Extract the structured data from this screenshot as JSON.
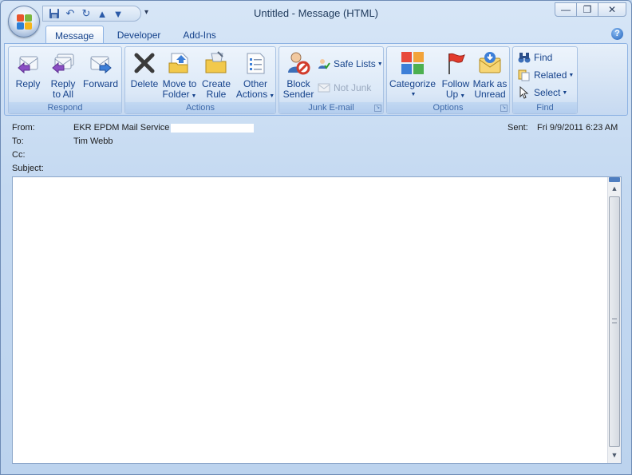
{
  "window": {
    "title": "Untitled - Message (HTML)",
    "controls": {
      "minimize": "—",
      "restore": "❐",
      "close": "✕"
    }
  },
  "qat": {
    "customize": "▾"
  },
  "tabs": [
    {
      "label": "Message",
      "active": true
    },
    {
      "label": "Developer",
      "active": false
    },
    {
      "label": "Add-Ins",
      "active": false
    }
  ],
  "help": "?",
  "ribbon": {
    "respond": {
      "label": "Respond",
      "reply": [
        "Reply",
        ""
      ],
      "reply_all": [
        "Reply",
        "to All"
      ],
      "forward": [
        "Forward",
        ""
      ]
    },
    "actions": {
      "label": "Actions",
      "delete": [
        "Delete",
        ""
      ],
      "move": [
        "Move to",
        "Folder"
      ],
      "create_rule": [
        "Create",
        "Rule"
      ],
      "other": [
        "Other",
        "Actions"
      ]
    },
    "junk": {
      "label": "Junk E-mail",
      "block": [
        "Block",
        "Sender"
      ],
      "safe_lists": "Safe Lists",
      "not_junk": "Not Junk"
    },
    "options": {
      "label": "Options",
      "categorize": [
        "Categorize",
        ""
      ],
      "follow_up": [
        "Follow",
        "Up"
      ],
      "mark_unread": [
        "Mark as",
        "Unread"
      ]
    },
    "find": {
      "label": "Find",
      "find": "Find",
      "related": "Related",
      "select": "Select"
    }
  },
  "header": {
    "from_label": "From:",
    "from_value": "EKR EPDM Mail Service",
    "to_label": "To:",
    "to_value": "Tim Webb",
    "cc_label": "Cc:",
    "subject_label": "Subject:",
    "sent_label": "Sent:",
    "sent_value": "Fri 9/9/2011 6:23 AM"
  },
  "colors": {
    "accent": "#15428b",
    "ribbon_bg": "#d3e2f4",
    "frame": "#bfd5ee"
  }
}
